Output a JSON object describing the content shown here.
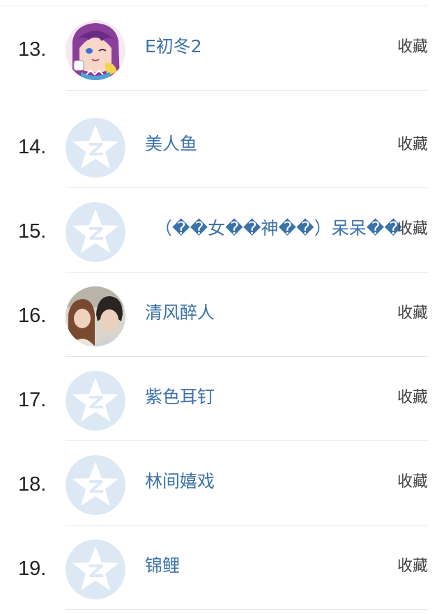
{
  "list": {
    "items": [
      {
        "rank": "13.",
        "name": "E初冬2",
        "action": "收藏",
        "avatar": "anime-girl-avatar"
      },
      {
        "rank": "14.",
        "name": "美人鱼",
        "action": "收藏",
        "avatar": "default-qq-star-avatar"
      },
      {
        "rank": "15.",
        "name": "（��女��神��）呆呆��",
        "action": "收藏",
        "avatar": "default-qq-star-avatar"
      },
      {
        "rank": "16.",
        "name": "清风醉人",
        "action": "收藏",
        "avatar": "couple-photo-avatar"
      },
      {
        "rank": "17.",
        "name": "紫色耳钉",
        "action": "收藏",
        "avatar": "default-qq-star-avatar"
      },
      {
        "rank": "18.",
        "name": "林间嬉戏",
        "action": "收藏",
        "avatar": "default-qq-star-avatar"
      },
      {
        "rank": "19.",
        "name": "锦鲤",
        "action": "收藏",
        "avatar": "default-qq-star-avatar"
      }
    ]
  },
  "colors": {
    "name_link": "#3b73a8",
    "rank_text": "#222222",
    "action_text": "#444444",
    "divider": "#e6e6e6",
    "default_avatar_bg": "#dde8f5"
  }
}
